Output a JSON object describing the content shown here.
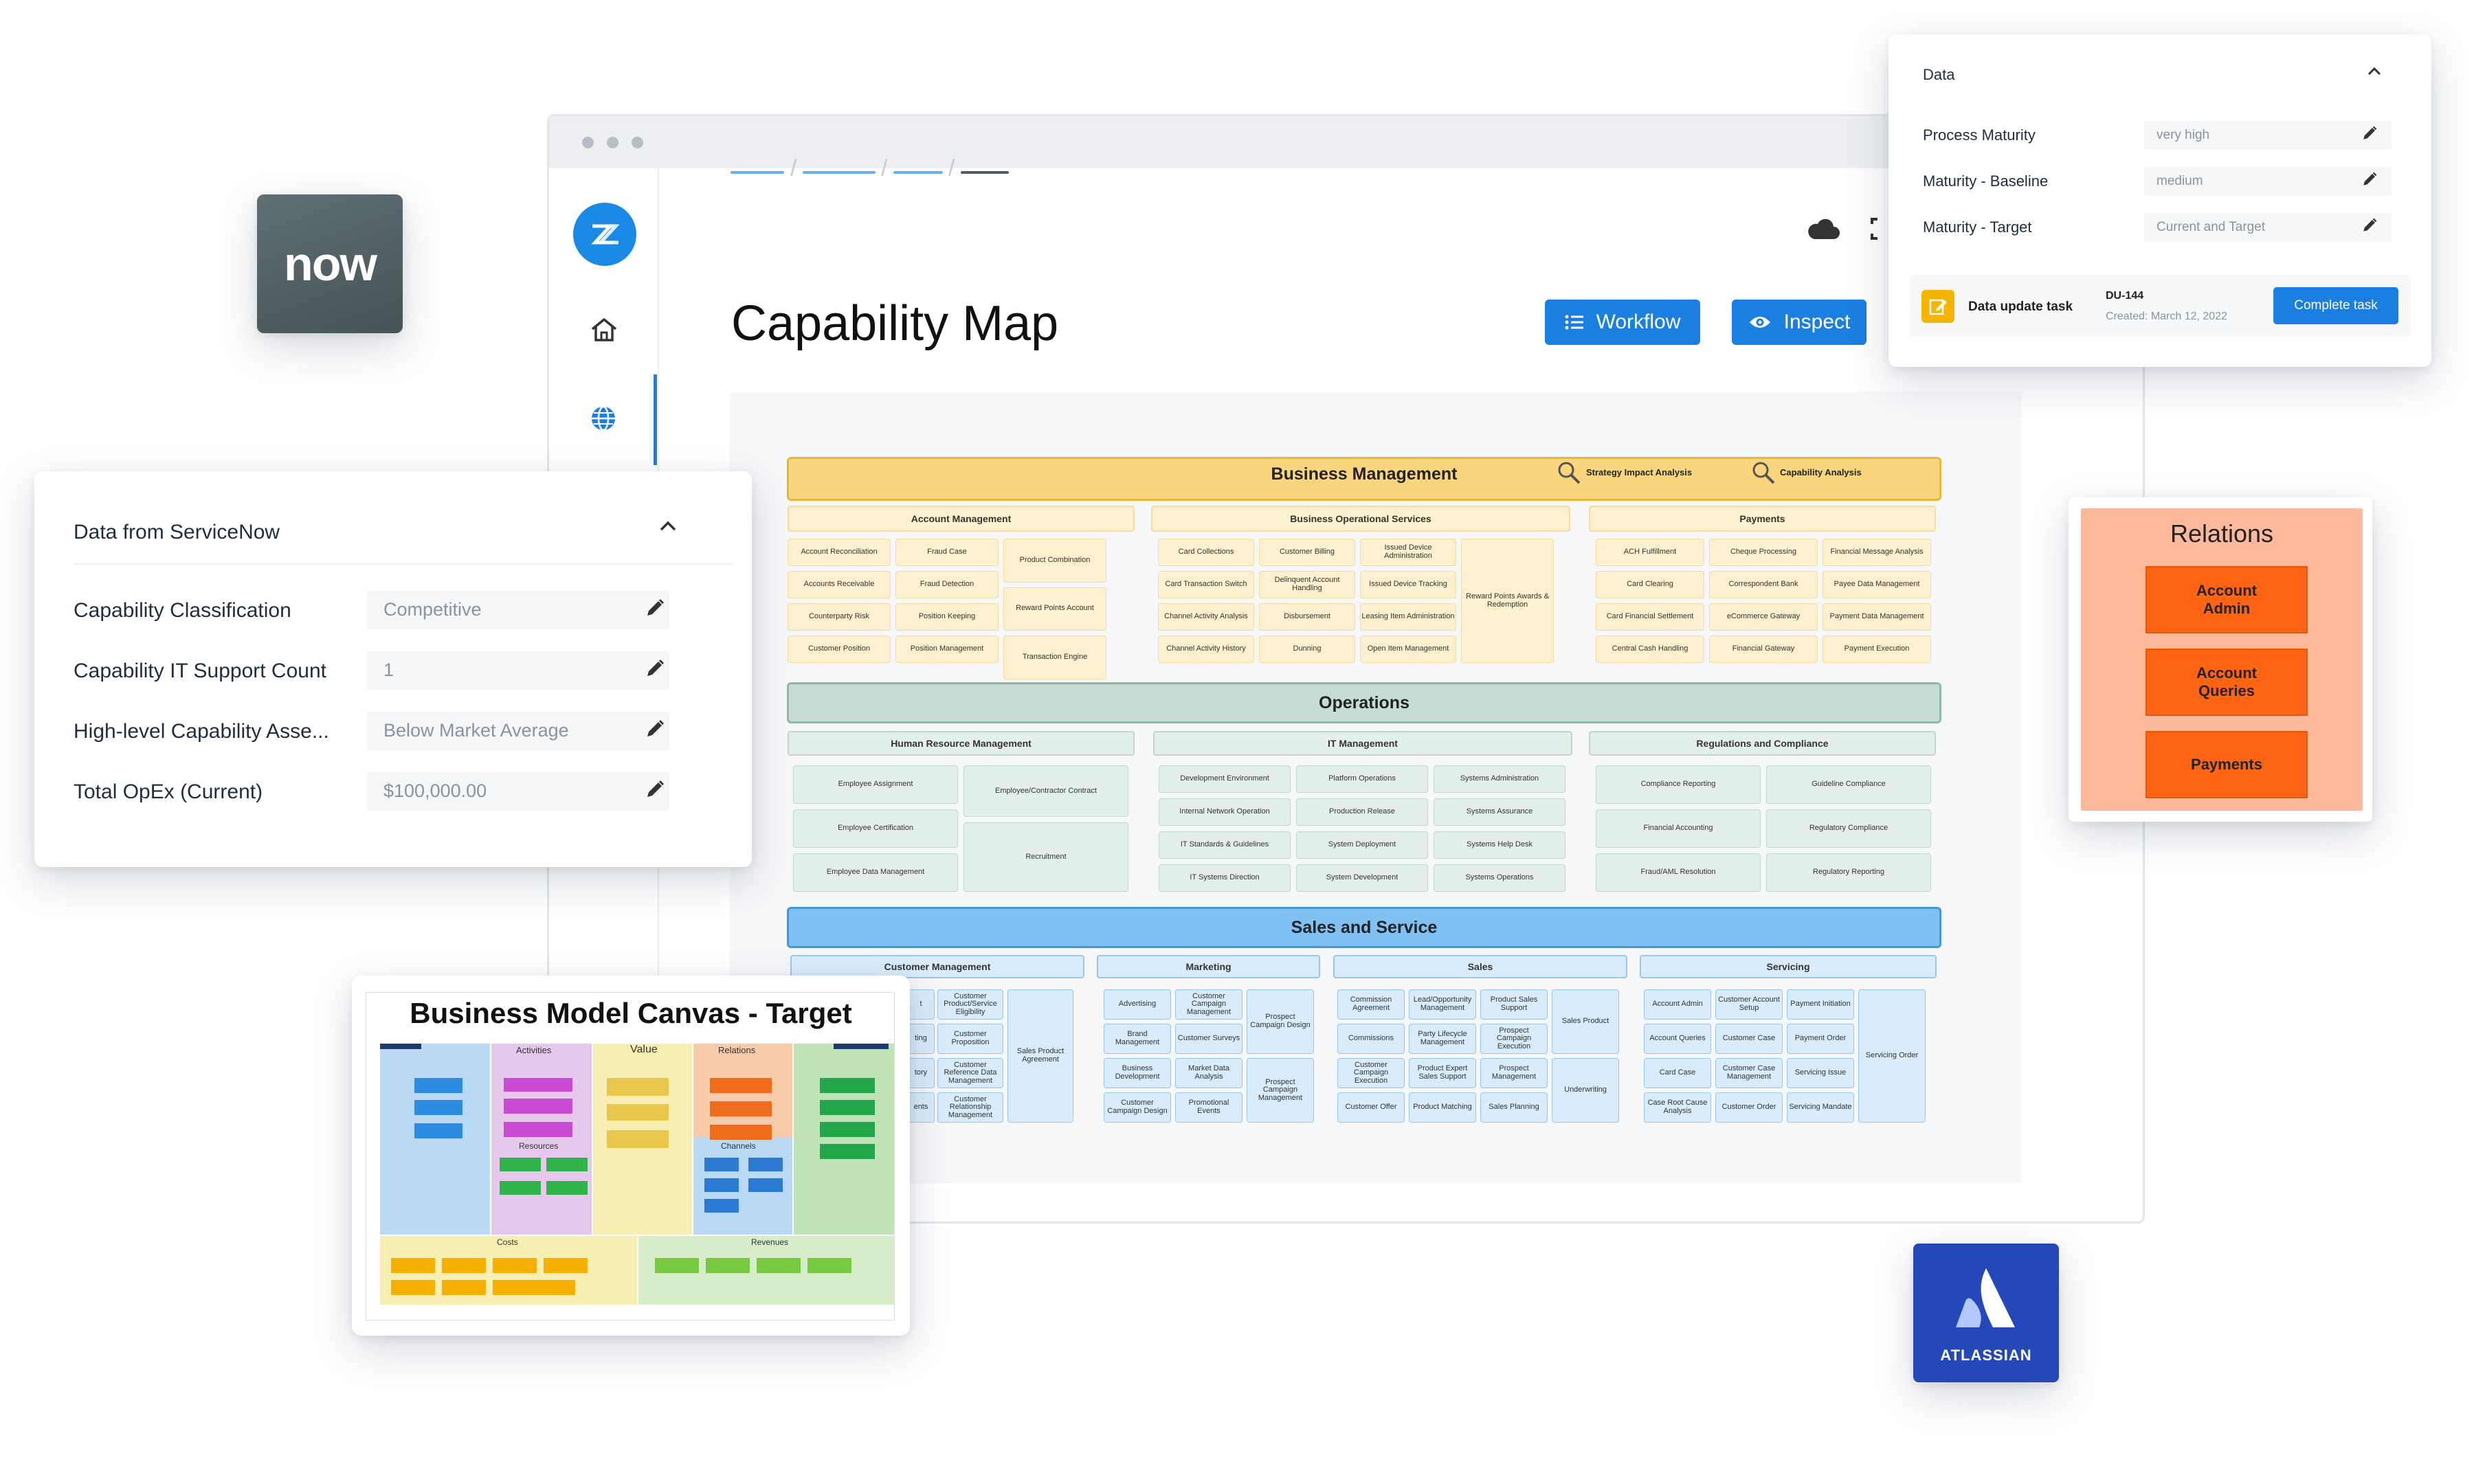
{
  "window": {
    "page_title": "Capability Map"
  },
  "toolbar": {
    "workflow_label": "Workflow",
    "inspect_label": "Inspect"
  },
  "logos": {
    "servicenow": "now",
    "atlassian": "ATLASSIAN"
  },
  "servicenow_panel": {
    "title": "Data from ServiceNow",
    "fields": [
      {
        "label": "Capability Classification",
        "value": "Competitive"
      },
      {
        "label": "Capability IT Support Count",
        "value": "1"
      },
      {
        "label": "High-level Capability Asse...",
        "value": "Below Market Average"
      },
      {
        "label": "Total OpEx (Current)",
        "value": "$100,000.00"
      }
    ]
  },
  "data_panel": {
    "title": "Data",
    "fields": [
      {
        "label": "Process Maturity",
        "value": "very high"
      },
      {
        "label": "Maturity - Baseline",
        "value": "medium"
      },
      {
        "label": "Maturity - Target",
        "value": "Current and Target"
      }
    ],
    "task": {
      "label": "Data update task",
      "id": "DU-144",
      "created": "Created: March 12, 2022",
      "button": "Complete task"
    }
  },
  "relations_panel": {
    "title": "Relations",
    "items": [
      "Account Admin",
      "Account Queries",
      "Payments"
    ]
  },
  "bmc": {
    "title": "Business Model Canvas - Target",
    "columns": [
      "Activities",
      "Value",
      "Relations"
    ],
    "row_labels": [
      "Resources",
      "Channels",
      "Costs",
      "Revenues"
    ]
  },
  "capability_map": {
    "business_management": {
      "title": "Business Management",
      "actions": [
        "Strategy Impact Analysis",
        "Capability Analysis"
      ],
      "account_management": {
        "title": "Account Management",
        "cells": [
          "Account Reconciliation",
          "Fraud Case",
          "Product Combination",
          "Accounts Receivable",
          "Fraud Detection",
          "Reward Points Account",
          "Counterparty Risk",
          "Position Keeping",
          "Transaction Engine",
          "Customer Position",
          "Position Management"
        ]
      },
      "business_operational_services": {
        "title": "Business Operational Services",
        "cells": [
          "Card Collections",
          "Customer Billing",
          "Issued Device Administration",
          "Card Transaction Switch",
          "Delinquent Account Handling",
          "Issued Device Tracking",
          "Channel Activity Analysis",
          "Disbursement",
          "Leasing Item Administration",
          "Channel Activity History",
          "Dunning",
          "Open Item Management",
          "Reward Points Awards & Redemption"
        ]
      },
      "payments": {
        "title": "Payments",
        "cells": [
          "ACH Fulfillment",
          "Cheque Processing",
          "Financial Message Analysis",
          "Card Clearing",
          "Correspondent Bank",
          "Payee Data Management",
          "Card Financial Settlement",
          "eCommerce Gateway",
          "Payment Data Management",
          "Central Cash Handling",
          "Financial Gateway",
          "Payment Execution"
        ]
      }
    },
    "operations": {
      "title": "Operations",
      "human_resource_management": {
        "title": "Human Resource Management",
        "cells": [
          "Employee Assignment",
          "Employee/Contractor Contract",
          "Employee Certification",
          "Recruitment",
          "Employee Data Management"
        ]
      },
      "it_management": {
        "title": "IT Management",
        "cells": [
          "Development Environment",
          "Platform Operations",
          "Systems Administration",
          "Internal Network Operation",
          "Production Release",
          "Systems Assurance",
          "IT Standards & Guidelines",
          "System Deployment",
          "Systems Help Desk",
          "IT Systems Direction",
          "System Development",
          "Systems Operations"
        ]
      },
      "regulations_and_compliance": {
        "title": "Regulations and Compliance",
        "cells": [
          "Compliance Reporting",
          "Guideline Compliance",
          "Financial Accounting",
          "Regulatory Compliance",
          "Fraud/AML Resolution",
          "Regulatory Reporting"
        ]
      }
    },
    "sales_and_service": {
      "title": "Sales and Service",
      "customer_management": {
        "title": "Customer Management",
        "cells": [
          "Customer Product/Service Eligibility",
          "Customer Proposition",
          "Customer Reference Data Management",
          "Customer Relationship Management",
          "Sales Product Agreement"
        ],
        "partial": [
          "t",
          "ting",
          "tory",
          "ents"
        ]
      },
      "marketing": {
        "title": "Marketing",
        "cells": [
          "Advertising",
          "Customer Campaign Management",
          "Prospect Campaign Design",
          "Brand Management",
          "Customer Surveys",
          "Business Development",
          "Market Data Analysis",
          "Prospect Campaign Management",
          "Customer Campaign Design",
          "Promotional Events"
        ]
      },
      "sales": {
        "title": "Sales",
        "cells": [
          "Commission Agreement",
          "Lead/Opportunity Management",
          "Product Sales Support",
          "Sales Product",
          "Commissions",
          "Party Lifecycle Management",
          "Prospect Campaign Execution",
          "Customer Campaign Execution",
          "Product Expert Sales Support",
          "Prospect Management",
          "Underwriting",
          "Customer Offer",
          "Product Matching",
          "Sales Planning"
        ]
      },
      "servicing": {
        "title": "Servicing",
        "cells": [
          "Account Admin",
          "Customer Account Setup",
          "Payment Initiation",
          "Servicing Order",
          "Account Queries",
          "Customer Case",
          "Payment Order",
          "Card Case",
          "Customer Case Management",
          "Servicing Issue",
          "Case Root Cause Analysis",
          "Customer Order",
          "Servicing Mandate"
        ]
      }
    }
  }
}
